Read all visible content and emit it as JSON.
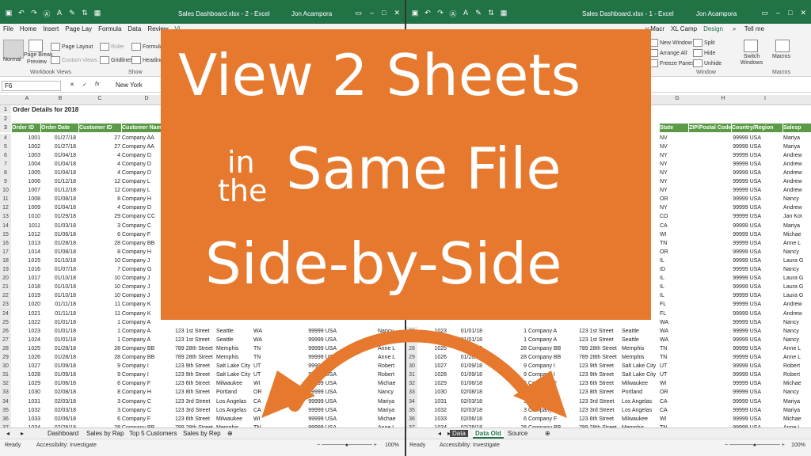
{
  "left": {
    "qat_icons": [
      "save-icon",
      "undo-icon",
      "redo-icon",
      "format-icon",
      "font-color-icon",
      "paint-icon",
      "sort-icon",
      "table-icon"
    ],
    "file_name": "Sales Dashboard.xlsx - 2 - Excel",
    "user": "Jon Acampora",
    "tabs": [
      "File",
      "Home",
      "Insert",
      "Page Lay",
      "Formula",
      "Data",
      "Review",
      "Vi"
    ],
    "ribbon": {
      "normal": "Normal",
      "page_break": "Page Break",
      "preview": "Preview",
      "page_layout": "Page Layout",
      "custom_views": "Custom Views",
      "ruler": "Ruler",
      "gridlines": "Gridlines",
      "formula_bar": "Formula B",
      "headings": "Headings",
      "group_label": "Workbook Views",
      "show_label": "Show"
    },
    "name_box": "F6",
    "formula": "New York",
    "columns": [
      "A",
      "B",
      "C",
      "D"
    ],
    "title_cell": "Order Details for 2018",
    "header_row": [
      "Order ID",
      "Order Date",
      "Customer ID",
      "Customer Name"
    ],
    "rows": [
      {
        "r": "4",
        "id": "1001",
        "date": "01/27/18",
        "cust": "27",
        "name": "Company AA"
      },
      {
        "r": "5",
        "id": "1002",
        "date": "01/27/18",
        "cust": "27",
        "name": "Company AA"
      },
      {
        "r": "6",
        "id": "1003",
        "date": "01/04/18",
        "cust": "4",
        "name": "Company D"
      },
      {
        "r": "7",
        "id": "1004",
        "date": "01/04/18",
        "cust": "4",
        "name": "Company D"
      },
      {
        "r": "8",
        "id": "1005",
        "date": "01/04/18",
        "cust": "4",
        "name": "Company D"
      },
      {
        "r": "9",
        "id": "1006",
        "date": "01/12/18",
        "cust": "12",
        "name": "Company L"
      },
      {
        "r": "10",
        "id": "1007",
        "date": "01/12/18",
        "cust": "12",
        "name": "Company L"
      },
      {
        "r": "11",
        "id": "1008",
        "date": "01/08/18",
        "cust": "8",
        "name": "Company H"
      },
      {
        "r": "12",
        "id": "1009",
        "date": "01/04/18",
        "cust": "4",
        "name": "Company D"
      },
      {
        "r": "13",
        "id": "1010",
        "date": "01/29/18",
        "cust": "29",
        "name": "Company CC"
      },
      {
        "r": "14",
        "id": "1011",
        "date": "01/03/18",
        "cust": "3",
        "name": "Company C"
      },
      {
        "r": "15",
        "id": "1012",
        "date": "01/06/18",
        "cust": "6",
        "name": "Company F"
      },
      {
        "r": "16",
        "id": "1013",
        "date": "01/28/18",
        "cust": "28",
        "name": "Company BB"
      },
      {
        "r": "17",
        "id": "1014",
        "date": "01/08/18",
        "cust": "8",
        "name": "Company H"
      },
      {
        "r": "18",
        "id": "1015",
        "date": "01/10/18",
        "cust": "10",
        "name": "Company J"
      },
      {
        "r": "19",
        "id": "1016",
        "date": "01/07/18",
        "cust": "7",
        "name": "Company G"
      },
      {
        "r": "20",
        "id": "1017",
        "date": "01/10/18",
        "cust": "10",
        "name": "Company J"
      },
      {
        "r": "21",
        "id": "1018",
        "date": "01/10/18",
        "cust": "10",
        "name": "Company J"
      },
      {
        "r": "22",
        "id": "1019",
        "date": "01/10/18",
        "cust": "10",
        "name": "Company J"
      },
      {
        "r": "23",
        "id": "1020",
        "date": "01/11/18",
        "cust": "11",
        "name": "Company K"
      },
      {
        "r": "24",
        "id": "1021",
        "date": "01/11/18",
        "cust": "11",
        "name": "Company K"
      },
      {
        "r": "25",
        "id": "1022",
        "date": "01/01/18",
        "cust": "1",
        "name": "Company A"
      },
      {
        "r": "26",
        "id": "1023",
        "date": "01/01/18",
        "cust": "1",
        "name": "Company A",
        "addr": "123 1st Street",
        "city": "Seattle",
        "st": "WA",
        "zip": "99999 USA",
        "sp": "Nancy"
      },
      {
        "r": "27",
        "id": "1024",
        "date": "01/01/18",
        "cust": "1",
        "name": "Company A",
        "addr": "123 1st Street",
        "city": "Seattle",
        "st": "WA",
        "zip": "99999 USA",
        "sp": "Nancy"
      },
      {
        "r": "28",
        "id": "1025",
        "date": "01/28/18",
        "cust": "28",
        "name": "Company BB",
        "addr": "789 28th Street",
        "city": "Memphis",
        "st": "TN",
        "zip": "99999 USA",
        "sp": "Anne L"
      },
      {
        "r": "29",
        "id": "1026",
        "date": "01/28/18",
        "cust": "28",
        "name": "Company BB",
        "addr": "789 28th Street",
        "city": "Memphis",
        "st": "TN",
        "zip": "99999 USA",
        "sp": "Anne L"
      },
      {
        "r": "30",
        "id": "1027",
        "date": "01/09/18",
        "cust": "9",
        "name": "Company I",
        "addr": "123 9th Street",
        "city": "Salt Lake City",
        "st": "UT",
        "zip": "99999 USA",
        "sp": "Robert"
      },
      {
        "r": "31",
        "id": "1028",
        "date": "01/09/18",
        "cust": "9",
        "name": "Company I",
        "addr": "123 9th Street",
        "city": "Salt Lake City",
        "st": "UT",
        "zip": "99999 USA",
        "sp": "Robert"
      },
      {
        "r": "32",
        "id": "1029",
        "date": "01/06/18",
        "cust": "6",
        "name": "Company F",
        "addr": "123 6th Street",
        "city": "Milwaukee",
        "st": "WI",
        "zip": "99999 USA",
        "sp": "Michae"
      },
      {
        "r": "33",
        "id": "1030",
        "date": "02/08/18",
        "cust": "8",
        "name": "Company H",
        "addr": "123 8th Street",
        "city": "Portland",
        "st": "OR",
        "zip": "99999 USA",
        "sp": "Nancy"
      },
      {
        "r": "34",
        "id": "1031",
        "date": "02/03/18",
        "cust": "3",
        "name": "Company C",
        "addr": "123 3rd Street",
        "city": "Los Angelas",
        "st": "CA",
        "zip": "99999 USA",
        "sp": "Mariya"
      },
      {
        "r": "35",
        "id": "1032",
        "date": "02/03/18",
        "cust": "3",
        "name": "Company C",
        "addr": "123 3rd Street",
        "city": "Los Angelas",
        "st": "CA",
        "zip": "99999 USA",
        "sp": "Mariya"
      },
      {
        "r": "36",
        "id": "1033",
        "date": "02/06/18",
        "cust": "6",
        "name": "Company F",
        "addr": "123 6th Street",
        "city": "Milwaukee",
        "st": "WI",
        "zip": "99999 USA",
        "sp": "Michae"
      },
      {
        "r": "37",
        "id": "1034",
        "date": "02/28/18",
        "cust": "28",
        "name": "Company BB",
        "addr": "789 28th Street",
        "city": "Memphis",
        "st": "TN",
        "zip": "99999 USA",
        "sp": "Anne L"
      },
      {
        "r": "38",
        "id": "1035",
        "date": "02/08/18",
        "cust": "8",
        "name": "Company H",
        "addr": "123 8th Street",
        "city": "Portland",
        "st": "OR",
        "zip": "99999 USA",
        "sp": "Nancy"
      }
    ],
    "sheet_tabs": [
      "Dashboard",
      "Sales by Rap",
      "Top 5 Customers",
      "Sales by Rep"
    ],
    "status_ready": "Ready",
    "accessibility": "Accessibility: Investigate",
    "zoom": "100%"
  },
  "right": {
    "file_name": "Sales Dashboard.xlsx - 1 - Excel",
    "user": "Jon Acampora",
    "tabs": [
      "y Macr",
      "XL Camp",
      "Design"
    ],
    "tell_me": "Tell me",
    "ribbon": {
      "new_window": "New Window",
      "arrange_all": "Arrange All",
      "freeze_panes": "Freeze Panes",
      "split": "Split",
      "hide": "Hide",
      "unhide": "Unhide",
      "switch_windows": "Switch Windows",
      "macros": "Macros",
      "window_label": "Window",
      "macros_label": "Macros"
    },
    "columns": [
      "G",
      "H",
      "I"
    ],
    "header_row": [
      "State",
      "ZIP/Postal Code",
      "Country/Region",
      "Salesp"
    ],
    "top_rows": [
      {
        "st": "NV",
        "zip": "99999 USA",
        "sp": "Mariya"
      },
      {
        "st": "NV",
        "zip": "99999 USA",
        "sp": "Mariya"
      },
      {
        "st": "NY",
        "zip": "99999 USA",
        "sp": "Andrew"
      },
      {
        "st": "NY",
        "zip": "99999 USA",
        "sp": "Andrew"
      },
      {
        "st": "NY",
        "zip": "99999 USA",
        "sp": "Andrew"
      },
      {
        "st": "NY",
        "zip": "99999 USA",
        "sp": "Andrew"
      },
      {
        "st": "NY",
        "zip": "99999 USA",
        "sp": "Andrew"
      },
      {
        "st": "OR",
        "zip": "99999 USA",
        "sp": "Nancy"
      },
      {
        "st": "NY",
        "zip": "99999 USA",
        "sp": "Andrew"
      },
      {
        "st": "CO",
        "zip": "99999 USA",
        "sp": "Jan Kot"
      },
      {
        "st": "CA",
        "zip": "99999 USA",
        "sp": "Mariya"
      },
      {
        "st": "WI",
        "zip": "99999 USA",
        "sp": "Michae"
      },
      {
        "st": "TN",
        "zip": "99999 USA",
        "sp": "Anne L"
      },
      {
        "st": "OR",
        "zip": "99999 USA",
        "sp": "Nancy"
      },
      {
        "st": "IL",
        "zip": "99999 USA",
        "sp": "Laura G"
      },
      {
        "st": "ID",
        "zip": "99999 USA",
        "sp": "Nancy"
      },
      {
        "st": "IL",
        "zip": "99999 USA",
        "sp": "Laura G"
      },
      {
        "st": "IL",
        "zip": "99999 USA",
        "sp": "Laura G"
      },
      {
        "st": "IL",
        "zip": "99999 USA",
        "sp": "Laura G"
      },
      {
        "st": "FL",
        "zip": "99999 USA",
        "sp": "Andrew"
      },
      {
        "st": "FL",
        "zip": "99999 USA",
        "sp": "Andrew"
      },
      {
        "st": "WA",
        "zip": "99999 USA",
        "sp": "Nancy"
      }
    ],
    "rows": [
      {
        "r": "26",
        "id": "1023",
        "date": "01/01/18",
        "cust": "1",
        "name": "Company A",
        "addr": "123 1st Street",
        "city": "Seattle",
        "st": "WA",
        "zip": "99999 USA",
        "sp": "Nancy"
      },
      {
        "r": "27",
        "id": "1024",
        "date": "01/01/18",
        "cust": "1",
        "name": "Company A",
        "addr": "123 1st Street",
        "city": "Seattle",
        "st": "WA",
        "zip": "99999 USA",
        "sp": "Nancy"
      },
      {
        "r": "28",
        "id": "1025",
        "date": "01/28/18",
        "cust": "28",
        "name": "Company BB",
        "addr": "789 28th Street",
        "city": "Memphis",
        "st": "TN",
        "zip": "99999 USA",
        "sp": "Anne L"
      },
      {
        "r": "29",
        "id": "1026",
        "date": "01/28/18",
        "cust": "28",
        "name": "Company BB",
        "addr": "789 28th Street",
        "city": "Memphis",
        "st": "TN",
        "zip": "99999 USA",
        "sp": "Anne L"
      },
      {
        "r": "30",
        "id": "1027",
        "date": "01/09/18",
        "cust": "9",
        "name": "Company I",
        "addr": "123 9th Street",
        "city": "Salt Lake City",
        "st": "UT",
        "zip": "99999 USA",
        "sp": "Robert"
      },
      {
        "r": "31",
        "id": "1028",
        "date": "01/09/18",
        "cust": "9",
        "name": "Company I",
        "addr": "123 9th Street",
        "city": "Salt Lake City",
        "st": "UT",
        "zip": "99999 USA",
        "sp": "Robert"
      },
      {
        "r": "32",
        "id": "1029",
        "date": "01/06/18",
        "cust": "6",
        "name": "Company F",
        "addr": "123 6th Street",
        "city": "Milwaukee",
        "st": "WI",
        "zip": "99999 USA",
        "sp": "Michae"
      },
      {
        "r": "33",
        "id": "1030",
        "date": "02/08/18",
        "cust": "8",
        "name": "Company H",
        "addr": "123 8th Street",
        "city": "Portland",
        "st": "OR",
        "zip": "99999 USA",
        "sp": "Nancy"
      },
      {
        "r": "34",
        "id": "1031",
        "date": "02/03/18",
        "cust": "3",
        "name": "Company C",
        "addr": "123 3rd Street",
        "city": "Los Angelas",
        "st": "CA",
        "zip": "99999 USA",
        "sp": "Mariya"
      },
      {
        "r": "35",
        "id": "1032",
        "date": "02/03/18",
        "cust": "3",
        "name": "Company C",
        "addr": "123 3rd Street",
        "city": "Los Angelas",
        "st": "CA",
        "zip": "99999 USA",
        "sp": "Mariya"
      },
      {
        "r": "36",
        "id": "1033",
        "date": "02/06/18",
        "cust": "6",
        "name": "Company F",
        "addr": "123 6th Street",
        "city": "Milwaukee",
        "st": "WI",
        "zip": "99999 USA",
        "sp": "Michae"
      },
      {
        "r": "37",
        "id": "1034",
        "date": "02/28/18",
        "cust": "28",
        "name": "Company BB",
        "addr": "789 28th Street",
        "city": "Memphis",
        "st": "TN",
        "zip": "99999 USA",
        "sp": "Anne L"
      },
      {
        "r": "38",
        "id": "1035",
        "date": "02/08/18",
        "cust": "8",
        "name": "Company H",
        "addr": "123 8th Street",
        "city": "Portland",
        "st": "OR",
        "zip": "99999 USA",
        "sp": "Nancy"
      }
    ],
    "sheet_tabs": [
      "Data",
      "Data Old",
      "Source"
    ],
    "status_ready": "Ready",
    "accessibility": "Accessibility: Investigate",
    "zoom": "100%"
  },
  "overlay": {
    "line1": "View 2 Sheets",
    "in": "in",
    "the": "the",
    "line2": "Same File",
    "line3": "Side-by-Side",
    "bg_color": "#e6792e",
    "arrow_color": "#e6792e"
  },
  "colors": {
    "excel_green": "#217346",
    "table_header": "#5b9b48"
  }
}
